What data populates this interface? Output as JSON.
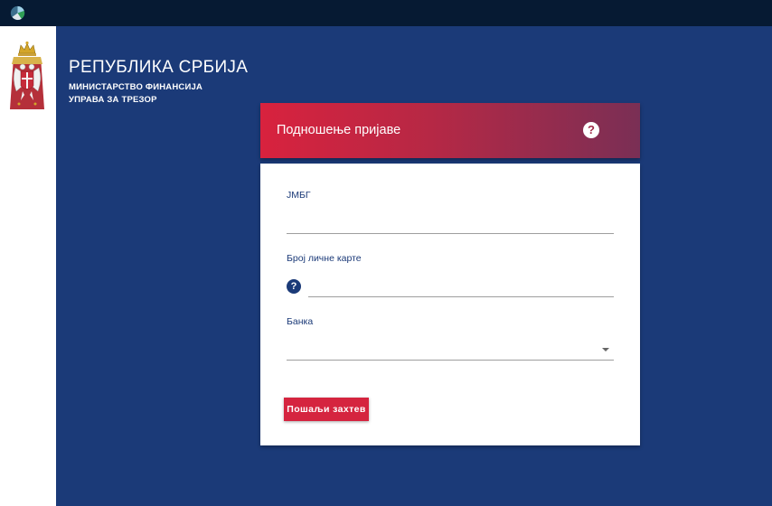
{
  "topbar": {
    "app_icon": "app-logo-icon"
  },
  "header": {
    "title": "РЕПУБЛИКА СРБИЈА",
    "ministry": "МИНИСТАРСТВО ФИНАНСИЈА",
    "directorate": "УПРАВА ЗА ТРЕЗОР",
    "emblem": "serbian-coat-of-arms"
  },
  "card": {
    "title": "Подношење пријаве",
    "help_icon": "?",
    "header_color": "#d8223e"
  },
  "form": {
    "jmbg_label": "ЈМБГ",
    "jmbg_value": "",
    "id_card_label": "Број личне карте",
    "id_card_value": "",
    "id_card_info_icon": "?",
    "bank_label": "Банка",
    "bank_value": "",
    "submit_label": "Пошаљи захтев"
  },
  "colors": {
    "background": "#1b3a78",
    "topbar": "#061a33",
    "accent": "#d5243f"
  }
}
